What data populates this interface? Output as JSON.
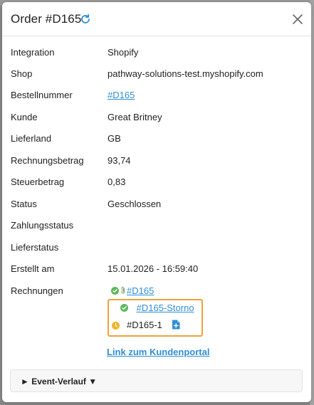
{
  "modal": {
    "title": "Order #D165",
    "icons": {
      "refresh": "refresh-icon",
      "close": "close-icon"
    }
  },
  "fields": [
    {
      "label": "Integration",
      "value": "Shopify"
    },
    {
      "label": "Shop",
      "value": "pathway-solutions-test.myshopify.com"
    },
    {
      "label": "Bestellnummer",
      "value": "#D165",
      "is_link": true
    },
    {
      "label": "Kunde",
      "value": "Great Britney"
    },
    {
      "label": "Lieferland",
      "value": "GB"
    },
    {
      "label": "Rechnungsbetrag",
      "value": "93,74"
    },
    {
      "label": "Steuerbetrag",
      "value": "0,83"
    },
    {
      "label": "Status",
      "value": "Geschlossen"
    },
    {
      "label": "Zahlungsstatus",
      "value": ""
    },
    {
      "label": "Lieferstatus",
      "value": ""
    },
    {
      "label": "Erstellt am",
      "value": "15.01.2026 - 16:59:40"
    },
    {
      "label": "Rechnungen",
      "value": ""
    }
  ],
  "invoices": [
    {
      "number": "#D165",
      "status_icon": "check-circle-icon",
      "attachment_icon": "paperclip-icon",
      "is_link": true
    },
    {
      "number": "#D165-Storno",
      "status_icon": "check-circle-icon",
      "is_link": true
    },
    {
      "number": "#D165-1",
      "status_icon": "clock-icon",
      "action_icon": "document-plus-icon",
      "is_link": false
    }
  ],
  "portal_link": "Link zum Kundenportal",
  "event_history": {
    "label": "► Event-Verlauf ▼"
  },
  "colors": {
    "link": "#2f8fd4",
    "success": "#5cb85c",
    "pending": "#f0b429",
    "highlight": "#f0a23a"
  }
}
